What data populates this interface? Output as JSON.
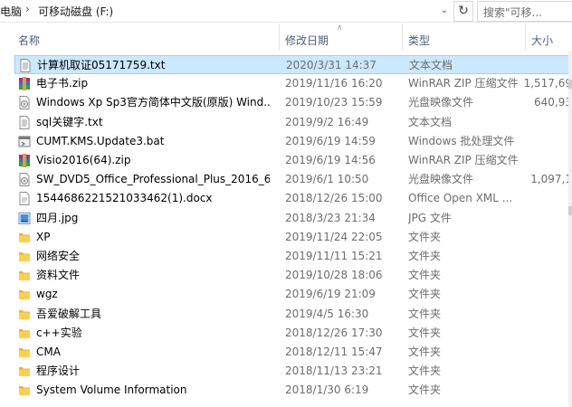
{
  "address": {
    "crumbs": [
      "电脑",
      "可移动磁盘 (F:)"
    ],
    "separator": "›",
    "dropdown_icon": "chevron-down-icon",
    "refresh_icon": "refresh-icon",
    "search_placeholder": "搜索\"可移..."
  },
  "columns": {
    "name": "名称",
    "date": "修改日期",
    "type": "类型",
    "size": "大小"
  },
  "rows": [
    {
      "name": "计算机取证05171759.txt",
      "date": "2020/3/31 14:37",
      "type": "文本文档",
      "size": "",
      "icon": "text-file-icon",
      "selected": true
    },
    {
      "name": "电子书.zip",
      "date": "2019/11/16 16:20",
      "type": "WinRAR ZIP 压缩文件",
      "size": "1,517,69",
      "icon": "winrar-zip-icon",
      "selected": false
    },
    {
      "name": "Windows Xp Sp3官方简体中文版(原版) Wind...",
      "date": "2019/10/23 15:59",
      "type": "光盘映像文件",
      "size": "640,93",
      "icon": "disc-image-icon",
      "selected": false
    },
    {
      "name": "sql关键字.txt",
      "date": "2019/9/2 16:49",
      "type": "文本文档",
      "size": "",
      "icon": "text-file-icon",
      "selected": false
    },
    {
      "name": "CUMT.KMS.Update3.bat",
      "date": "2019/6/19 14:59",
      "type": "Windows 批处理文件",
      "size": "",
      "icon": "batch-file-icon",
      "selected": false
    },
    {
      "name": "Visio2016(64).zip",
      "date": "2019/6/19 14:56",
      "type": "WinRAR ZIP 压缩文件",
      "size": "",
      "icon": "winrar-zip-icon",
      "selected": false
    },
    {
      "name": "SW_DVD5_Office_Professional_Plus_2016_6...",
      "date": "2019/6/1 10:50",
      "type": "光盘映像文件",
      "size": "1,097,1",
      "icon": "disc-image-icon",
      "selected": false
    },
    {
      "name": "1544686221521033462(1).docx",
      "date": "2018/12/26 15:00",
      "type": "Office Open XML ...",
      "size": "",
      "icon": "docx-file-icon",
      "selected": false
    },
    {
      "name": "四月.jpg",
      "date": "2018/3/23 21:34",
      "type": "JPG 文件",
      "size": "",
      "icon": "image-file-icon",
      "selected": false
    },
    {
      "name": "XP",
      "date": "2019/11/24 22:05",
      "type": "文件夹",
      "size": "",
      "icon": "folder-icon",
      "selected": false
    },
    {
      "name": "网络安全",
      "date": "2019/11/11 15:21",
      "type": "文件夹",
      "size": "",
      "icon": "folder-icon",
      "selected": false
    },
    {
      "name": "资料文件",
      "date": "2019/10/28 18:06",
      "type": "文件夹",
      "size": "",
      "icon": "folder-icon",
      "selected": false
    },
    {
      "name": "wgz",
      "date": "2019/6/19 21:09",
      "type": "文件夹",
      "size": "",
      "icon": "folder-icon",
      "selected": false
    },
    {
      "name": "吾爱破解工具",
      "date": "2019/4/5 16:30",
      "type": "文件夹",
      "size": "",
      "icon": "folder-icon",
      "selected": false
    },
    {
      "name": "c++实验",
      "date": "2018/12/26 17:30",
      "type": "文件夹",
      "size": "",
      "icon": "folder-icon",
      "selected": false
    },
    {
      "name": "CMA",
      "date": "2018/12/11 15:47",
      "type": "文件夹",
      "size": "",
      "icon": "folder-icon",
      "selected": false
    },
    {
      "name": "程序设计",
      "date": "2018/11/13 23:21",
      "type": "文件夹",
      "size": "",
      "icon": "folder-icon",
      "selected": false
    },
    {
      "name": "System Volume Information",
      "date": "2018/1/30 6:19",
      "type": "文件夹",
      "size": "",
      "icon": "folder-icon",
      "selected": false
    }
  ]
}
